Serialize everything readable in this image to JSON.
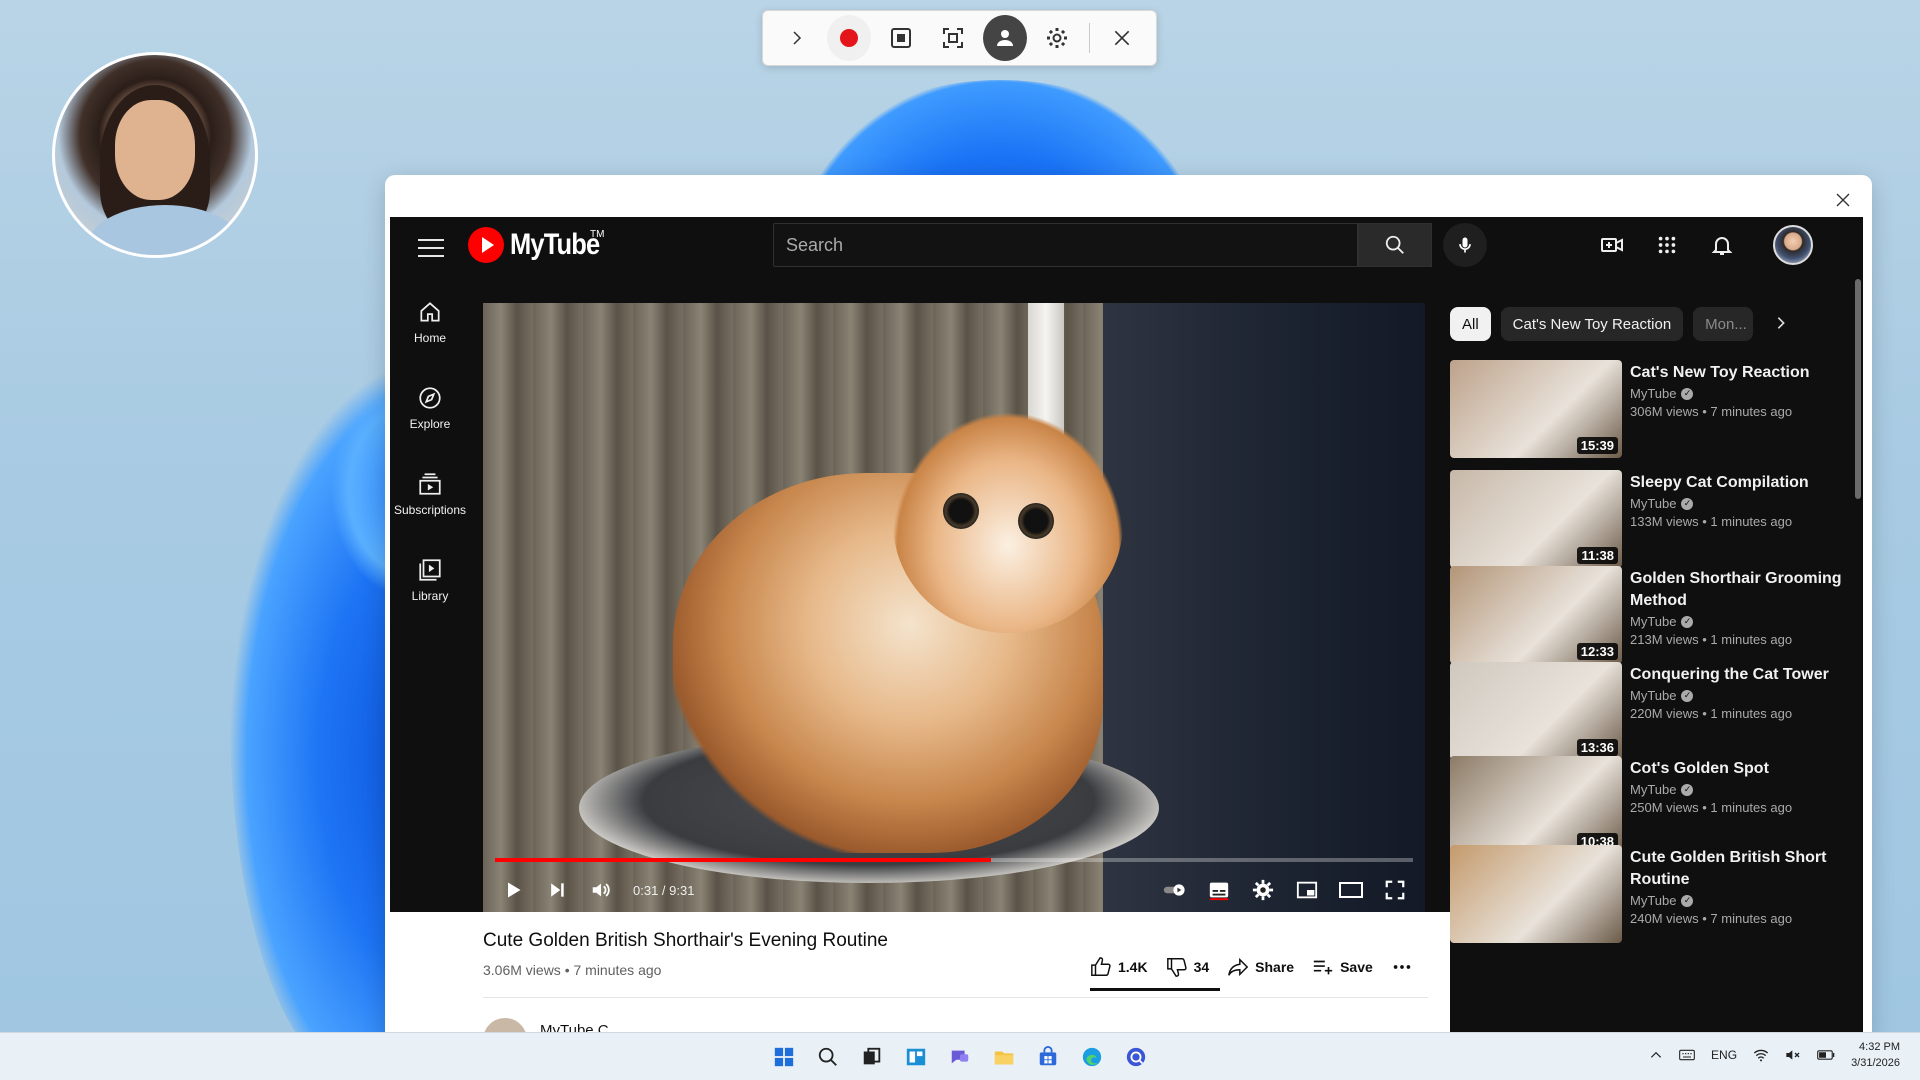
{
  "recorder": {
    "buttons": [
      "expand",
      "record",
      "stop",
      "capture-region",
      "webcam",
      "settings",
      "close"
    ]
  },
  "app": {
    "logo_text": "MyTube",
    "logo_tm": "TM",
    "search_placeholder": "Search"
  },
  "rail": {
    "items": [
      {
        "label": "Home",
        "icon": "home-icon"
      },
      {
        "label": "Explore",
        "icon": "compass-icon"
      },
      {
        "label": "Subscriptions",
        "icon": "subscriptions-icon"
      },
      {
        "label": "Library",
        "icon": "library-icon"
      }
    ]
  },
  "player": {
    "time": "0:31 / 9:31",
    "progress": 0.54
  },
  "video": {
    "title": "Cute Golden British Shorthair's Evening Routine",
    "meta": "3.06M views • 7 minutes ago",
    "likes": "1.4K",
    "dislikes": "34",
    "share_label": "Share",
    "save_label": "Save",
    "channel_name": "MyTube C..."
  },
  "chips": [
    "All",
    "Cat's New Toy Reaction",
    "Mon..."
  ],
  "recommendations": [
    {
      "title": "Cat's New Toy Reaction",
      "channel": "MyTube",
      "meta": "306M views • 7 minutes ago",
      "duration": "15:39",
      "thumb_color": "#bda28a"
    },
    {
      "title": "Sleepy Cat Compilation",
      "channel": "MyTube",
      "meta": "133M views • 1 minutes ago",
      "duration": "11:38",
      "thumb_color": "#c7b8a8"
    },
    {
      "title": "Golden Shorthair Grooming Method",
      "channel": "MyTube",
      "meta": "213M views • 1 minutes ago",
      "duration": "12:33",
      "thumb_color": "#b39577"
    },
    {
      "title": "Conquering the Cat Tower",
      "channel": "MyTube",
      "meta": "220M views • 1 minutes ago",
      "duration": "13:36",
      "thumb_color": "#cfc8bf"
    },
    {
      "title": "Cot's Golden Spot",
      "channel": "MyTube",
      "meta": "250M views • 1 minutes ago",
      "duration": "10:38",
      "thumb_color": "#8c7a66"
    },
    {
      "title": "Cute Golden British Short Routine",
      "channel": "MyTube",
      "meta": "240M views • 7 minutes ago",
      "duration": "",
      "thumb_color": "#c49a6c"
    }
  ],
  "taskbar": {
    "tray_lang": "ENG",
    "time": "4:32 PM",
    "date": "3/31/2026"
  }
}
